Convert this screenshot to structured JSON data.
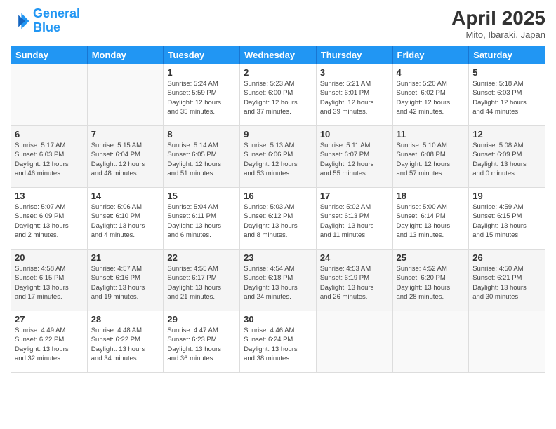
{
  "header": {
    "logo_line1": "General",
    "logo_line2": "Blue",
    "title": "April 2025",
    "location": "Mito, Ibaraki, Japan"
  },
  "weekdays": [
    "Sunday",
    "Monday",
    "Tuesday",
    "Wednesday",
    "Thursday",
    "Friday",
    "Saturday"
  ],
  "weeks": [
    [
      {
        "day": "",
        "info": ""
      },
      {
        "day": "",
        "info": ""
      },
      {
        "day": "1",
        "info": "Sunrise: 5:24 AM\nSunset: 5:59 PM\nDaylight: 12 hours\nand 35 minutes."
      },
      {
        "day": "2",
        "info": "Sunrise: 5:23 AM\nSunset: 6:00 PM\nDaylight: 12 hours\nand 37 minutes."
      },
      {
        "day": "3",
        "info": "Sunrise: 5:21 AM\nSunset: 6:01 PM\nDaylight: 12 hours\nand 39 minutes."
      },
      {
        "day": "4",
        "info": "Sunrise: 5:20 AM\nSunset: 6:02 PM\nDaylight: 12 hours\nand 42 minutes."
      },
      {
        "day": "5",
        "info": "Sunrise: 5:18 AM\nSunset: 6:03 PM\nDaylight: 12 hours\nand 44 minutes."
      }
    ],
    [
      {
        "day": "6",
        "info": "Sunrise: 5:17 AM\nSunset: 6:03 PM\nDaylight: 12 hours\nand 46 minutes."
      },
      {
        "day": "7",
        "info": "Sunrise: 5:15 AM\nSunset: 6:04 PM\nDaylight: 12 hours\nand 48 minutes."
      },
      {
        "day": "8",
        "info": "Sunrise: 5:14 AM\nSunset: 6:05 PM\nDaylight: 12 hours\nand 51 minutes."
      },
      {
        "day": "9",
        "info": "Sunrise: 5:13 AM\nSunset: 6:06 PM\nDaylight: 12 hours\nand 53 minutes."
      },
      {
        "day": "10",
        "info": "Sunrise: 5:11 AM\nSunset: 6:07 PM\nDaylight: 12 hours\nand 55 minutes."
      },
      {
        "day": "11",
        "info": "Sunrise: 5:10 AM\nSunset: 6:08 PM\nDaylight: 12 hours\nand 57 minutes."
      },
      {
        "day": "12",
        "info": "Sunrise: 5:08 AM\nSunset: 6:09 PM\nDaylight: 13 hours\nand 0 minutes."
      }
    ],
    [
      {
        "day": "13",
        "info": "Sunrise: 5:07 AM\nSunset: 6:09 PM\nDaylight: 13 hours\nand 2 minutes."
      },
      {
        "day": "14",
        "info": "Sunrise: 5:06 AM\nSunset: 6:10 PM\nDaylight: 13 hours\nand 4 minutes."
      },
      {
        "day": "15",
        "info": "Sunrise: 5:04 AM\nSunset: 6:11 PM\nDaylight: 13 hours\nand 6 minutes."
      },
      {
        "day": "16",
        "info": "Sunrise: 5:03 AM\nSunset: 6:12 PM\nDaylight: 13 hours\nand 8 minutes."
      },
      {
        "day": "17",
        "info": "Sunrise: 5:02 AM\nSunset: 6:13 PM\nDaylight: 13 hours\nand 11 minutes."
      },
      {
        "day": "18",
        "info": "Sunrise: 5:00 AM\nSunset: 6:14 PM\nDaylight: 13 hours\nand 13 minutes."
      },
      {
        "day": "19",
        "info": "Sunrise: 4:59 AM\nSunset: 6:15 PM\nDaylight: 13 hours\nand 15 minutes."
      }
    ],
    [
      {
        "day": "20",
        "info": "Sunrise: 4:58 AM\nSunset: 6:15 PM\nDaylight: 13 hours\nand 17 minutes."
      },
      {
        "day": "21",
        "info": "Sunrise: 4:57 AM\nSunset: 6:16 PM\nDaylight: 13 hours\nand 19 minutes."
      },
      {
        "day": "22",
        "info": "Sunrise: 4:55 AM\nSunset: 6:17 PM\nDaylight: 13 hours\nand 21 minutes."
      },
      {
        "day": "23",
        "info": "Sunrise: 4:54 AM\nSunset: 6:18 PM\nDaylight: 13 hours\nand 24 minutes."
      },
      {
        "day": "24",
        "info": "Sunrise: 4:53 AM\nSunset: 6:19 PM\nDaylight: 13 hours\nand 26 minutes."
      },
      {
        "day": "25",
        "info": "Sunrise: 4:52 AM\nSunset: 6:20 PM\nDaylight: 13 hours\nand 28 minutes."
      },
      {
        "day": "26",
        "info": "Sunrise: 4:50 AM\nSunset: 6:21 PM\nDaylight: 13 hours\nand 30 minutes."
      }
    ],
    [
      {
        "day": "27",
        "info": "Sunrise: 4:49 AM\nSunset: 6:22 PM\nDaylight: 13 hours\nand 32 minutes."
      },
      {
        "day": "28",
        "info": "Sunrise: 4:48 AM\nSunset: 6:22 PM\nDaylight: 13 hours\nand 34 minutes."
      },
      {
        "day": "29",
        "info": "Sunrise: 4:47 AM\nSunset: 6:23 PM\nDaylight: 13 hours\nand 36 minutes."
      },
      {
        "day": "30",
        "info": "Sunrise: 4:46 AM\nSunset: 6:24 PM\nDaylight: 13 hours\nand 38 minutes."
      },
      {
        "day": "",
        "info": ""
      },
      {
        "day": "",
        "info": ""
      },
      {
        "day": "",
        "info": ""
      }
    ]
  ]
}
